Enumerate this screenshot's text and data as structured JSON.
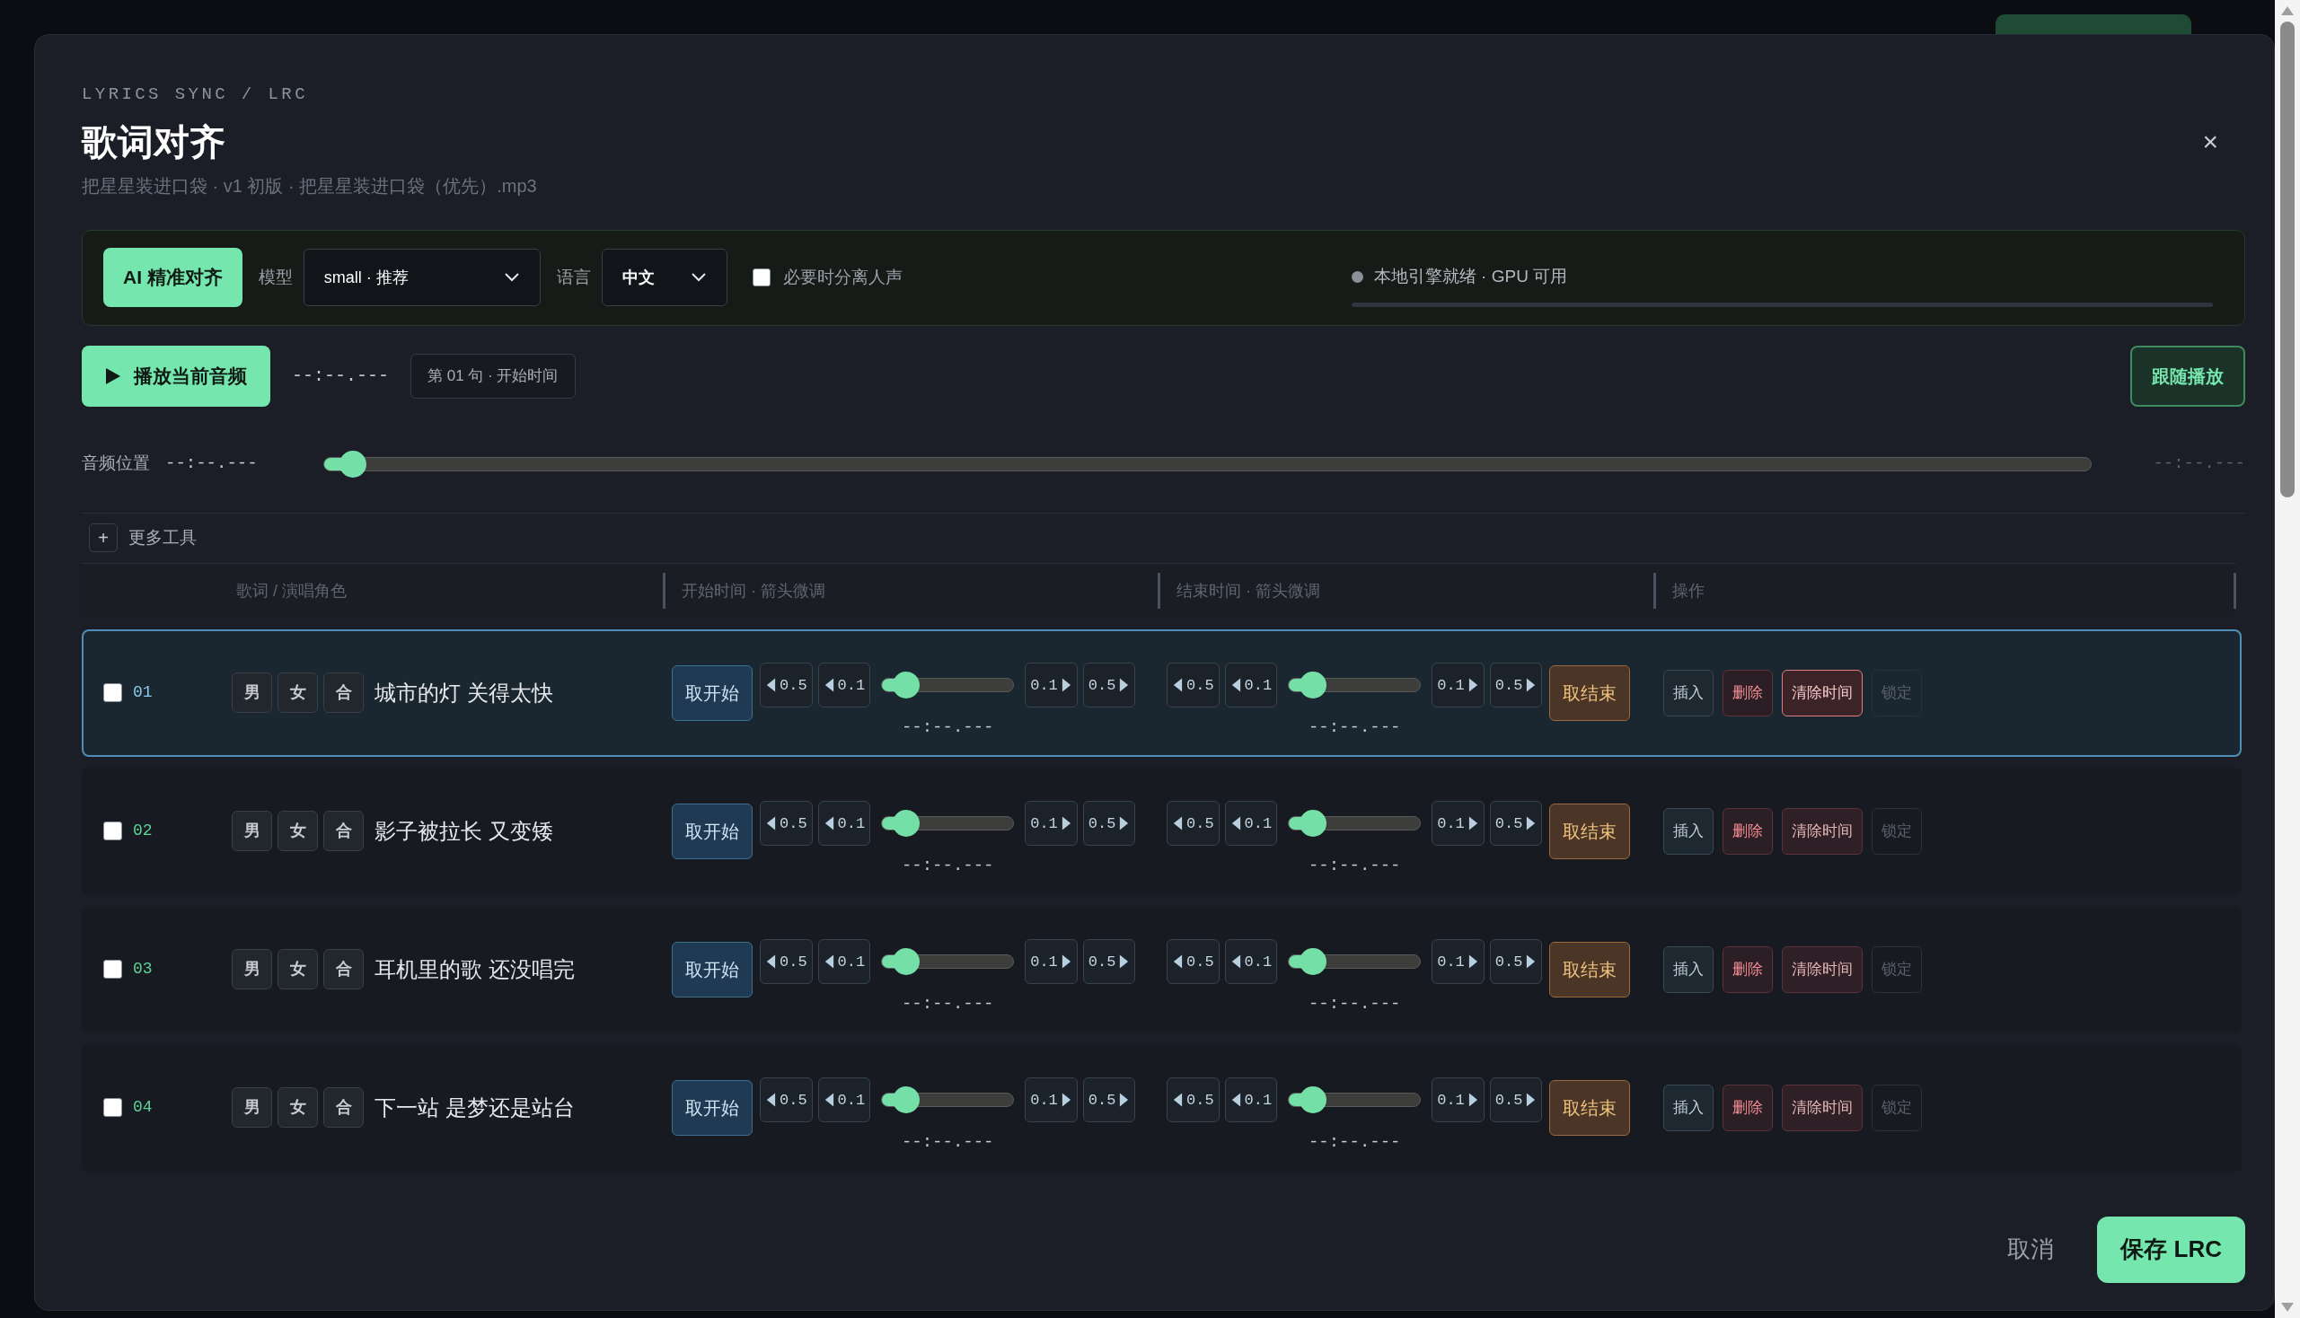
{
  "breadcrumb": "LYRICS SYNC / LRC",
  "title": "歌词对齐",
  "subtitle": "把星星装进口袋 · v1 初版 · 把星星装进口袋（优先）.mp3",
  "close": "×",
  "toolbar": {
    "ai_button": "AI 精准对齐",
    "model_label": "模型",
    "model_value": "small · 推荐",
    "language_label": "语言",
    "language_value": "中文",
    "separate_vocals": {
      "label": "必要时分离人声",
      "checked": false
    },
    "status": {
      "text": "本地引擎就绪 · GPU 可用",
      "color": "#8a8f9a"
    }
  },
  "playback": {
    "play_button": "播放当前音频",
    "time": "--:--.---",
    "cursor": "第 01 句 · 开始时间",
    "follow_button": "跟随播放"
  },
  "position": {
    "label": "音频位置",
    "time": "--:--.---",
    "level": 0.01,
    "end_time": "--:--.---"
  },
  "more_tools": {
    "icon": "+",
    "label": "更多工具"
  },
  "columns": [
    "歌词 / 演唱角色",
    "开始时间 · 箭头微调",
    "结束时间 · 箭头微调",
    "操作"
  ],
  "rows": [
    {
      "number": "01",
      "selected": true,
      "checked": false,
      "roles": [
        "男",
        "女",
        "合"
      ],
      "lyric": "城市的灯 关得太快",
      "start": {
        "button": "取开始",
        "nudges": [
          {
            "kind": "left",
            "label": "0.5"
          },
          {
            "kind": "left",
            "label": "0.1"
          },
          {
            "kind": "right",
            "label": "0.1"
          },
          {
            "kind": "right",
            "label": "0.5"
          }
        ],
        "level": 0.1,
        "time": "--:--.---"
      },
      "end": {
        "button": "取结束",
        "nudges": [
          {
            "kind": "left",
            "label": "0.5"
          },
          {
            "kind": "left",
            "label": "0.1"
          },
          {
            "kind": "right",
            "label": "0.1"
          },
          {
            "kind": "right",
            "label": "0.5"
          }
        ],
        "level": 0.1,
        "time": "--:--.---"
      },
      "actions": [
        {
          "kind": "insert",
          "label": "插入"
        },
        {
          "kind": "delete",
          "label": "删除"
        },
        {
          "kind": "clear",
          "label": "清除时间"
        },
        {
          "kind": "lock",
          "label": "锁定",
          "disabled": true
        }
      ]
    },
    {
      "number": "02",
      "selected": false,
      "checked": false,
      "roles": [
        "男",
        "女",
        "合"
      ],
      "lyric": "影子被拉长 又变矮",
      "start": {
        "button": "取开始",
        "nudges": [
          {
            "kind": "left",
            "label": "0.5"
          },
          {
            "kind": "left",
            "label": "0.1"
          },
          {
            "kind": "right",
            "label": "0.1"
          },
          {
            "kind": "right",
            "label": "0.5"
          }
        ],
        "level": 0.1,
        "time": "--:--.---"
      },
      "end": {
        "button": "取结束",
        "nudges": [
          {
            "kind": "left",
            "label": "0.5"
          },
          {
            "kind": "left",
            "label": "0.1"
          },
          {
            "kind": "right",
            "label": "0.1"
          },
          {
            "kind": "right",
            "label": "0.5"
          }
        ],
        "level": 0.1,
        "time": "--:--.---"
      },
      "actions": [
        {
          "kind": "insert",
          "label": "插入"
        },
        {
          "kind": "delete",
          "label": "删除"
        },
        {
          "kind": "clear",
          "label": "清除时间"
        },
        {
          "kind": "lock",
          "label": "锁定",
          "disabled": true
        }
      ]
    },
    {
      "number": "03",
      "selected": false,
      "checked": false,
      "roles": [
        "男",
        "女",
        "合"
      ],
      "lyric": "耳机里的歌 还没唱完",
      "start": {
        "button": "取开始",
        "nudges": [
          {
            "kind": "left",
            "label": "0.5"
          },
          {
            "kind": "left",
            "label": "0.1"
          },
          {
            "kind": "right",
            "label": "0.1"
          },
          {
            "kind": "right",
            "label": "0.5"
          }
        ],
        "level": 0.1,
        "time": "--:--.---"
      },
      "end": {
        "button": "取结束",
        "nudges": [
          {
            "kind": "left",
            "label": "0.5"
          },
          {
            "kind": "left",
            "label": "0.1"
          },
          {
            "kind": "right",
            "label": "0.1"
          },
          {
            "kind": "right",
            "label": "0.5"
          }
        ],
        "level": 0.1,
        "time": "--:--.---"
      },
      "actions": [
        {
          "kind": "insert",
          "label": "插入"
        },
        {
          "kind": "delete",
          "label": "删除"
        },
        {
          "kind": "clear",
          "label": "清除时间"
        },
        {
          "kind": "lock",
          "label": "锁定",
          "disabled": true
        }
      ]
    },
    {
      "number": "04",
      "selected": false,
      "checked": false,
      "roles": [
        "男",
        "女",
        "合"
      ],
      "lyric": "下一站 是梦还是站台",
      "start": {
        "button": "取开始",
        "nudges": [
          {
            "kind": "left",
            "label": "0.5"
          },
          {
            "kind": "left",
            "label": "0.1"
          },
          {
            "kind": "right",
            "label": "0.1"
          },
          {
            "kind": "right",
            "label": "0.5"
          }
        ],
        "level": 0.1,
        "time": "--:--.---"
      },
      "end": {
        "button": "取结束",
        "nudges": [
          {
            "kind": "left",
            "label": "0.5"
          },
          {
            "kind": "left",
            "label": "0.1"
          },
          {
            "kind": "right",
            "label": "0.1"
          },
          {
            "kind": "right",
            "label": "0.5"
          }
        ],
        "level": 0.1,
        "time": "--:--.---"
      },
      "actions": [
        {
          "kind": "insert",
          "label": "插入"
        },
        {
          "kind": "delete",
          "label": "删除"
        },
        {
          "kind": "clear",
          "label": "清除时间"
        },
        {
          "kind": "lock",
          "label": "锁定",
          "disabled": true
        }
      ]
    }
  ],
  "footer": {
    "cancel": "取消",
    "save": "保存 LRC"
  }
}
